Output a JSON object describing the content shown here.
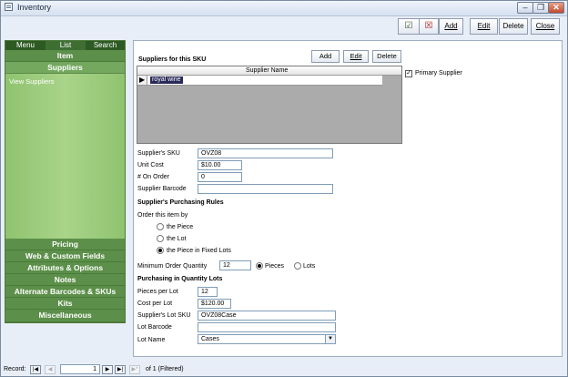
{
  "window": {
    "title": "Inventory"
  },
  "toolbar": {
    "edit": "Edit",
    "delete": "Delete",
    "close": "Close",
    "add": "Add"
  },
  "nav": {
    "tabs": [
      "Menu",
      "List",
      "Search"
    ],
    "item": "Item",
    "suppliers": "Suppliers",
    "view_suppliers": "View Suppliers",
    "sections": [
      "Pricing",
      "Web & Custom Fields",
      "Attributes & Options",
      "Notes",
      "Alternate Barcodes & SKUs",
      "Kits",
      "Miscellaneous"
    ]
  },
  "suppliers": {
    "heading": "Suppliers for this SKU",
    "add": "Add",
    "edit": "Edit",
    "delete": "Delete",
    "column": "Supplier Name",
    "row": "royal wine",
    "primary": "Primary Supplier"
  },
  "form": {
    "sku_label": "Supplier's SKU",
    "sku": "OVZ08",
    "unit_cost_label": "Unit Cost",
    "unit_cost": "$10.00",
    "on_order_label": "# On Order",
    "on_order": "0",
    "barcode_label": "Supplier Barcode",
    "barcode": ""
  },
  "rules": {
    "heading": "Supplier's Purchasing Rules",
    "order_by": "Order this item by",
    "opt_piece": "the Piece",
    "opt_lot": "the Lot",
    "opt_fixed": "the Piece in Fixed Lots",
    "min_label": "Minimum Order Quantity",
    "min_value": "12",
    "pieces": "Pieces",
    "lots": "Lots"
  },
  "lots": {
    "heading": "Purchasing in Quantity Lots",
    "pieces_per_lot_label": "Pieces per Lot",
    "pieces_per_lot": "12",
    "cost_per_lot_label": "Cost per Lot",
    "cost_per_lot": "$120.00",
    "lot_sku_label": "Supplier's Lot SKU",
    "lot_sku": "OVZ08Case",
    "lot_barcode_label": "Lot Barcode",
    "lot_barcode": "",
    "lot_name_label": "Lot Name",
    "lot_name": "Cases"
  },
  "status": {
    "record_label": "Record:",
    "current": "1",
    "of": "of  1 (Filtered)"
  }
}
